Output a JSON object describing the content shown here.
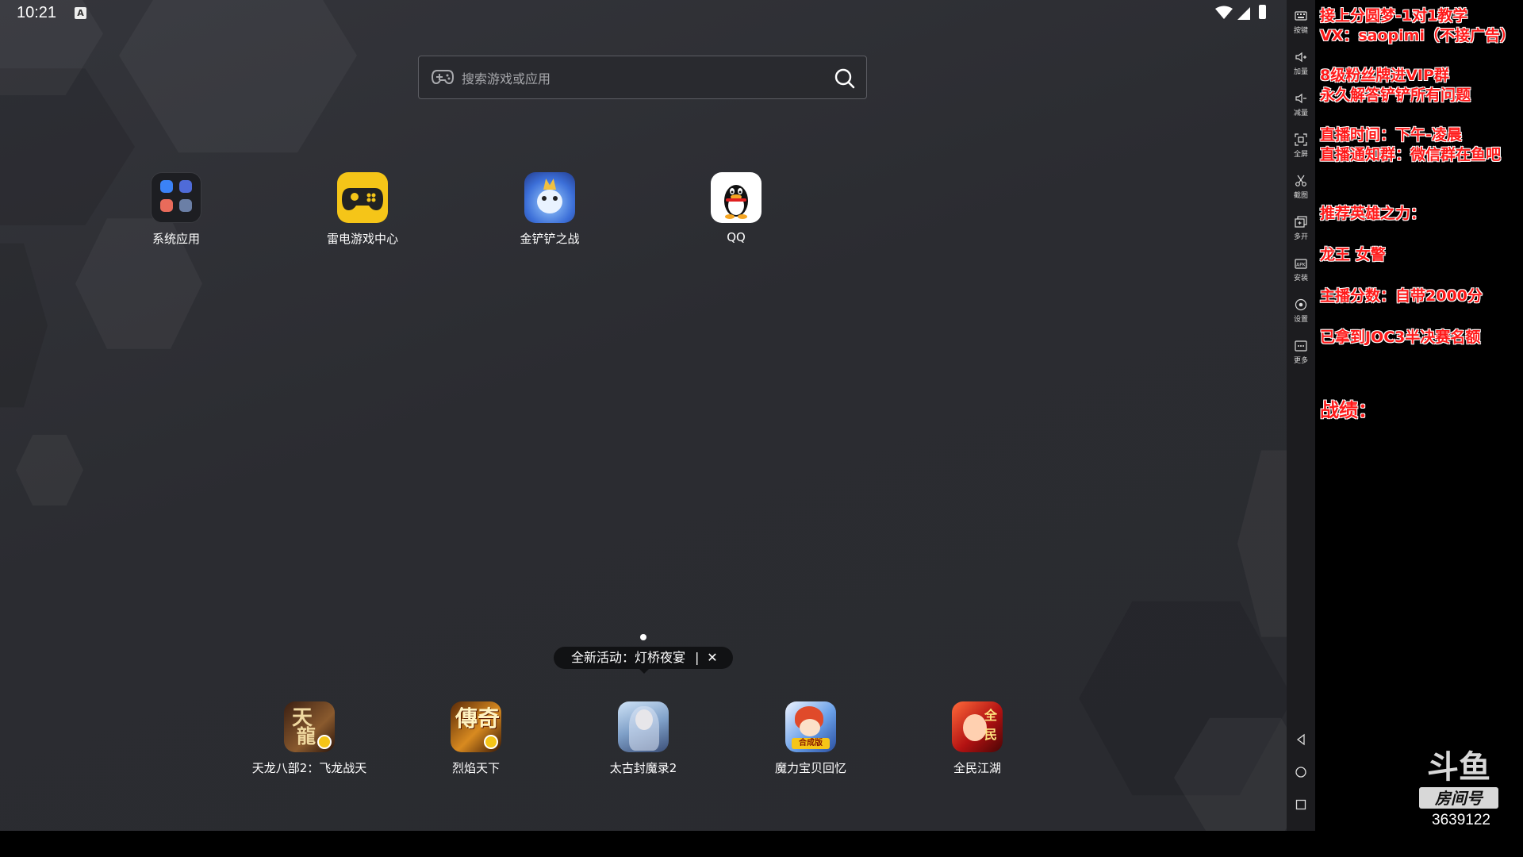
{
  "status_bar": {
    "time": "10:21",
    "notification_icon": "a-icon",
    "wifi_icon": "wifi-icon",
    "signal_icon": "signal-icon",
    "battery_icon": "battery-icon"
  },
  "search": {
    "placeholder": "搜索游戏或应用",
    "left_icon": "gamepad-icon",
    "right_icon": "search-icon"
  },
  "desktop_apps": [
    {
      "label": "系统应用",
      "icon": "system-apps-folder-icon"
    },
    {
      "label": "雷电游戏中心",
      "icon": "game-center-icon",
      "color": "#f5c518"
    },
    {
      "label": "金铲铲之战",
      "icon": "tft-game-icon"
    },
    {
      "label": "QQ",
      "icon": "qq-penguin-icon"
    }
  ],
  "dock_apps": [
    {
      "label": "天龙八部2：飞龙战天",
      "icon": "tianlong-icon"
    },
    {
      "label": "烈焰天下",
      "icon": "lieyan-icon",
      "icon_text": "傳奇"
    },
    {
      "label": "太古封魔录2",
      "icon": "taigu-icon"
    },
    {
      "label": "魔力宝贝回忆",
      "icon": "moli-icon",
      "badge": "合成版"
    },
    {
      "label": "全民江湖",
      "icon": "quanmin-icon",
      "icon_text": "全民"
    }
  ],
  "promo": {
    "text": "全新活动：灯桥夜宴",
    "separator": "|",
    "close": "✕"
  },
  "toolbar": [
    {
      "label": "按键",
      "icon": "keyboard-icon"
    },
    {
      "label": "加量",
      "icon": "volume-up-icon"
    },
    {
      "label": "减量",
      "icon": "volume-down-icon"
    },
    {
      "label": "全屏",
      "icon": "fullscreen-icon"
    },
    {
      "label": "截图",
      "icon": "scissors-icon"
    },
    {
      "label": "多开",
      "icon": "multi-instance-icon"
    },
    {
      "label": "安装",
      "icon": "install-apk-icon"
    },
    {
      "label": "设置",
      "icon": "settings-icon"
    },
    {
      "label": "更多",
      "icon": "more-icon"
    }
  ],
  "nav": {
    "back": "back-icon",
    "home": "home-icon",
    "recents": "recents-icon"
  },
  "stream_panel": {
    "lines": [
      "接上分圆梦-1对1教学",
      "VX：saopimi（不接广告）",
      "8级粉丝牌进VIP群",
      "永久解答铲铲所有问题",
      "直播时间：下午-凌晨",
      "直播通知群：微信群在鱼吧",
      "推荐英雄之力：",
      "龙王 女警",
      "主播分数：自带2000分",
      "已拿到JOC3半决赛名额",
      "战绩："
    ],
    "accent_color": "#ff1a1a",
    "logo_text": "斗鱼",
    "room_label": "房间号",
    "room_number": "3639122"
  }
}
